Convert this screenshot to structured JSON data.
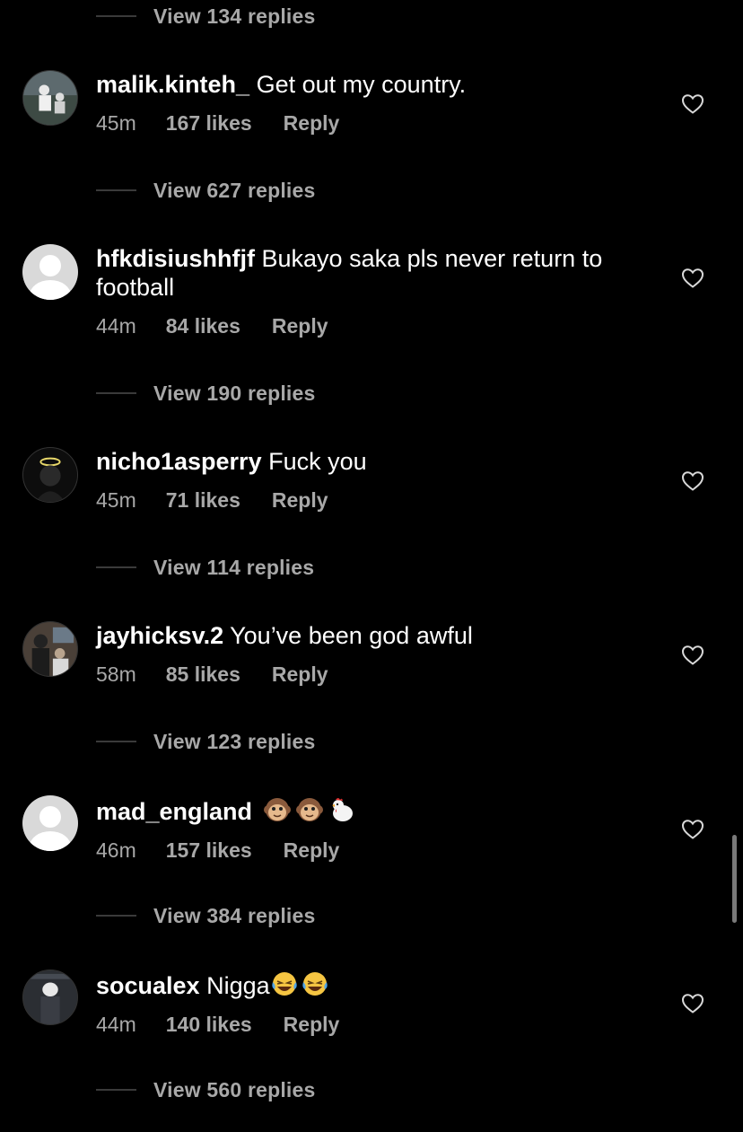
{
  "top_replies_label": "View 134 replies",
  "comments": [
    {
      "username": "malik.kinteh_",
      "text": "Get out my country.",
      "time": "45m",
      "likes": "167 likes",
      "reply_label": "Reply",
      "replies_label": "View 627 replies",
      "avatar": "photo"
    },
    {
      "username": "hfkdisiushhfjf",
      "text": "Bukayo saka pls never return to football",
      "time": "44m",
      "likes": "84 likes",
      "reply_label": "Reply",
      "replies_label": "View 190 replies",
      "avatar": "default"
    },
    {
      "username": "nicho1asperry",
      "text": "Fuck you",
      "time": "45m",
      "likes": "71 likes",
      "reply_label": "Reply",
      "replies_label": "View 114 replies",
      "avatar": "photo"
    },
    {
      "username": "jayhicksv.2",
      "text": "You’ve been god awful",
      "time": "58m",
      "likes": "85 likes",
      "reply_label": "Reply",
      "replies_label": "View 123 replies",
      "avatar": "photo"
    },
    {
      "username": "mad_england",
      "text": "",
      "emojis": [
        "monkey-face-emoji",
        "monkey-face-emoji",
        "chicken-emoji"
      ],
      "time": "46m",
      "likes": "157 likes",
      "reply_label": "Reply",
      "replies_label": "View 384 replies",
      "avatar": "default"
    },
    {
      "username": "socualex",
      "text": "Nigga",
      "emojis": [
        "laughing-tears-emoji",
        "laughing-tears-emoji"
      ],
      "time": "44m",
      "likes": "140 likes",
      "reply_label": "Reply",
      "replies_label": "View 560 replies",
      "avatar": "photo"
    }
  ],
  "colors": {
    "background": "#000000",
    "primary_text": "#ffffff",
    "secondary_text": "#a8a8a8"
  }
}
